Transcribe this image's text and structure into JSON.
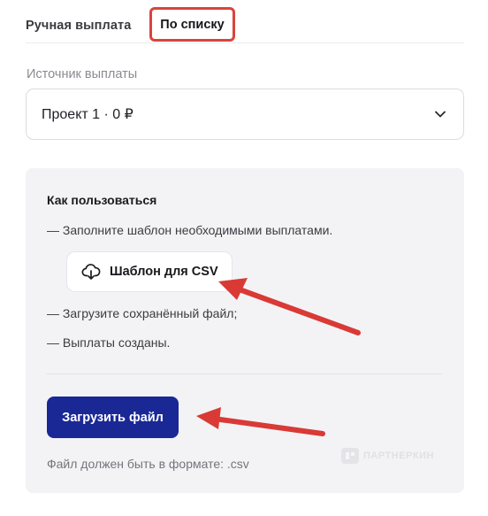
{
  "tabs": {
    "manual_label": "Ручная выплата",
    "list_label": "По списку"
  },
  "source": {
    "label": "Источник выплаты",
    "selected_value": "Проект 1 · 0 ₽"
  },
  "instructions": {
    "title": "Как пользоваться",
    "step1": "— Заполните шаблон необходимыми выплатами.",
    "template_button_label": "Шаблон для CSV",
    "step2": "— Загрузите сохранённый файл;",
    "step3": "— Выплаты созданы."
  },
  "upload": {
    "button_label": "Загрузить файл",
    "format_note": "Файл должен быть в формате: .csv"
  },
  "watermark": {
    "text": "ПАРТНЕРКИН"
  },
  "colors": {
    "highlight": "#d9443c",
    "primary": "#1a2896",
    "annotation_arrow": "#d93a35"
  },
  "icons": {
    "select_chevron": "chevron-down-icon",
    "template_download": "cloud-download-icon",
    "watermark_logo": "partnerkin-logo-icon"
  }
}
